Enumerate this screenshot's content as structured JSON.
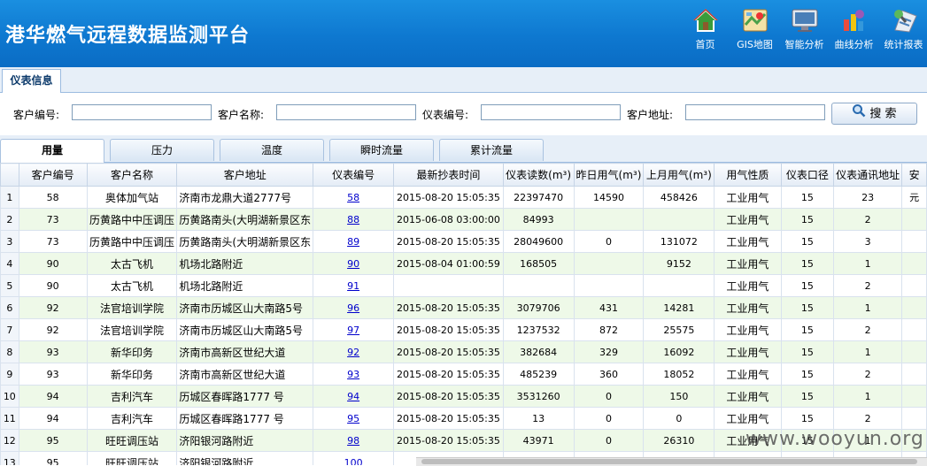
{
  "app": {
    "title": "港华燃气远程数据监测平台"
  },
  "nav": [
    {
      "label": "首页",
      "icon": "home-icon"
    },
    {
      "label": "GIS地图",
      "icon": "map-icon"
    },
    {
      "label": "智能分析",
      "icon": "monitor-icon"
    },
    {
      "label": "曲线分析",
      "icon": "chart-icon"
    },
    {
      "label": "统计报表",
      "icon": "report-icon"
    }
  ],
  "page_tab": {
    "label": "仪表信息"
  },
  "search": {
    "customer_id_label": "客户编号:",
    "customer_name_label": "客户名称:",
    "meter_id_label": "仪表编号:",
    "customer_addr_label": "客户地址:",
    "button_label": "搜 索",
    "customer_id_value": "",
    "customer_name_value": "",
    "meter_id_value": "",
    "customer_addr_value": ""
  },
  "subtabs": [
    {
      "label": "用量",
      "active": true
    },
    {
      "label": "压力",
      "active": false
    },
    {
      "label": "温度",
      "active": false
    },
    {
      "label": "瞬时流量",
      "active": false
    },
    {
      "label": "累计流量",
      "active": false
    }
  ],
  "table": {
    "columns": [
      "",
      "客户编号",
      "客户名称",
      "客户地址",
      "仪表编号",
      "最新抄表时间",
      "仪表读数(m³)",
      "昨日用气(m³)",
      "上月用气(m³)",
      "用气性质",
      "仪表口径",
      "仪表通讯地址",
      "安"
    ],
    "rows": [
      [
        "1",
        "58",
        "奥体加气站",
        "济南市龙鼎大道2777号",
        "58",
        "2015-08-20 15:05:35",
        "22397470",
        "14590",
        "458426",
        "工业用气",
        "15",
        "23",
        "元"
      ],
      [
        "2",
        "73",
        "历黄路中中压调压",
        "历黄路南头(大明湖新景区东",
        "88",
        "2015-06-08 03:00:00",
        "84993",
        "",
        "",
        "工业用气",
        "15",
        "2",
        ""
      ],
      [
        "3",
        "73",
        "历黄路中中压调压",
        "历黄路南头(大明湖新景区东",
        "89",
        "2015-08-20 15:05:35",
        "28049600",
        "0",
        "131072",
        "工业用气",
        "15",
        "3",
        ""
      ],
      [
        "4",
        "90",
        "太古飞机",
        "机场北路附近",
        "90",
        "2015-08-04 01:00:59",
        "168505",
        "",
        "9152",
        "工业用气",
        "15",
        "1",
        ""
      ],
      [
        "5",
        "90",
        "太古飞机",
        "机场北路附近",
        "91",
        "",
        "",
        "",
        "",
        "工业用气",
        "15",
        "2",
        ""
      ],
      [
        "6",
        "92",
        "法官培训学院",
        "济南市历城区山大南路5号",
        "96",
        "2015-08-20 15:05:35",
        "3079706",
        "431",
        "14281",
        "工业用气",
        "15",
        "1",
        ""
      ],
      [
        "7",
        "92",
        "法官培训学院",
        "济南市历城区山大南路5号",
        "97",
        "2015-08-20 15:05:35",
        "1237532",
        "872",
        "25575",
        "工业用气",
        "15",
        "2",
        ""
      ],
      [
        "8",
        "93",
        "新华印务",
        "济南市高新区世纪大道",
        "92",
        "2015-08-20 15:05:35",
        "382684",
        "329",
        "16092",
        "工业用气",
        "15",
        "1",
        ""
      ],
      [
        "9",
        "93",
        "新华印务",
        "济南市高新区世纪大道",
        "93",
        "2015-08-20 15:05:35",
        "485239",
        "360",
        "18052",
        "工业用气",
        "15",
        "2",
        ""
      ],
      [
        "10",
        "94",
        "吉利汽车",
        "历城区春晖路1777 号",
        "94",
        "2015-08-20 15:05:35",
        "3531260",
        "0",
        "150",
        "工业用气",
        "15",
        "1",
        ""
      ],
      [
        "11",
        "94",
        "吉利汽车",
        "历城区春晖路1777 号",
        "95",
        "2015-08-20 15:05:35",
        "13",
        "0",
        "0",
        "工业用气",
        "15",
        "2",
        ""
      ],
      [
        "12",
        "95",
        "旺旺调压站",
        "济阳银河路附近",
        "98",
        "2015-08-20 15:05:35",
        "43971",
        "0",
        "26310",
        "工业用气",
        "15",
        "1",
        ""
      ],
      [
        "13",
        "95",
        "旺旺调压站",
        "济阳银河路附近",
        "100",
        "",
        "",
        "",
        "",
        "",
        "",
        "",
        ""
      ]
    ]
  },
  "watermark": "www.wooyun.org"
}
